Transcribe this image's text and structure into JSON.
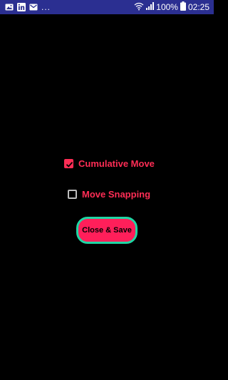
{
  "status_bar": {
    "notification_icons": [
      "gallery-icon",
      "linkedin-icon",
      "email-icon"
    ],
    "more_indicator": "...",
    "battery_percent": "100%",
    "time": "02:25"
  },
  "options": {
    "cumulative_move": {
      "label": "Cumulative Move",
      "checked": true
    },
    "move_snapping": {
      "label": "Move Snapping",
      "checked": false
    }
  },
  "save_button": {
    "label": "Close & Save"
  },
  "colors": {
    "status_bar_bg": "#2b2f91",
    "accent": "#ff2d55",
    "button_border": "#1fd6a4",
    "background": "#000000"
  }
}
